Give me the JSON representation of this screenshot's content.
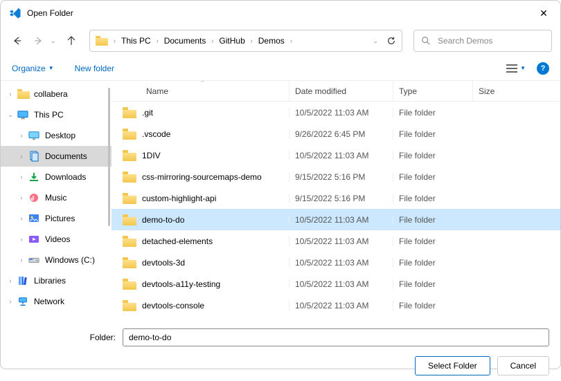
{
  "window": {
    "title": "Open Folder"
  },
  "nav": {
    "breadcrumbs": [
      "This PC",
      "Documents",
      "GitHub",
      "Demos"
    ]
  },
  "search": {
    "placeholder": "Search Demos"
  },
  "toolbar": {
    "organize": "Organize",
    "new_folder": "New folder"
  },
  "tree": [
    {
      "label": "collabera",
      "indent": 0,
      "expanded": false,
      "icon": "folder",
      "selected": false
    },
    {
      "label": "This PC",
      "indent": 0,
      "expanded": true,
      "icon": "pc",
      "selected": false
    },
    {
      "label": "Desktop",
      "indent": 1,
      "expanded": false,
      "icon": "desktop",
      "selected": false
    },
    {
      "label": "Documents",
      "indent": 1,
      "expanded": false,
      "icon": "documents",
      "selected": true
    },
    {
      "label": "Downloads",
      "indent": 1,
      "expanded": false,
      "icon": "downloads",
      "selected": false
    },
    {
      "label": "Music",
      "indent": 1,
      "expanded": false,
      "icon": "music",
      "selected": false
    },
    {
      "label": "Pictures",
      "indent": 1,
      "expanded": false,
      "icon": "pictures",
      "selected": false
    },
    {
      "label": "Videos",
      "indent": 1,
      "expanded": false,
      "icon": "videos",
      "selected": false
    },
    {
      "label": "Windows (C:)",
      "indent": 1,
      "expanded": false,
      "icon": "drive",
      "selected": false
    },
    {
      "label": "Libraries",
      "indent": 0,
      "expanded": false,
      "icon": "libraries",
      "selected": false
    },
    {
      "label": "Network",
      "indent": 0,
      "expanded": false,
      "icon": "network",
      "selected": false
    }
  ],
  "columns": {
    "name": "Name",
    "date": "Date modified",
    "type": "Type",
    "size": "Size"
  },
  "files": [
    {
      "name": ".git",
      "date": "10/5/2022 11:03 AM",
      "type": "File folder",
      "selected": false
    },
    {
      "name": ".vscode",
      "date": "9/26/2022 6:45 PM",
      "type": "File folder",
      "selected": false
    },
    {
      "name": "1DIV",
      "date": "10/5/2022 11:03 AM",
      "type": "File folder",
      "selected": false
    },
    {
      "name": "css-mirroring-sourcemaps-demo",
      "date": "9/15/2022 5:16 PM",
      "type": "File folder",
      "selected": false
    },
    {
      "name": "custom-highlight-api",
      "date": "9/15/2022 5:16 PM",
      "type": "File folder",
      "selected": false
    },
    {
      "name": "demo-to-do",
      "date": "10/5/2022 11:03 AM",
      "type": "File folder",
      "selected": true
    },
    {
      "name": "detached-elements",
      "date": "10/5/2022 11:03 AM",
      "type": "File folder",
      "selected": false
    },
    {
      "name": "devtools-3d",
      "date": "10/5/2022 11:03 AM",
      "type": "File folder",
      "selected": false
    },
    {
      "name": "devtools-a11y-testing",
      "date": "10/5/2022 11:03 AM",
      "type": "File folder",
      "selected": false
    },
    {
      "name": "devtools-console",
      "date": "10/5/2022 11:03 AM",
      "type": "File folder",
      "selected": false
    }
  ],
  "footer": {
    "folder_label": "Folder:",
    "folder_value": "demo-to-do",
    "select": "Select Folder",
    "cancel": "Cancel"
  }
}
